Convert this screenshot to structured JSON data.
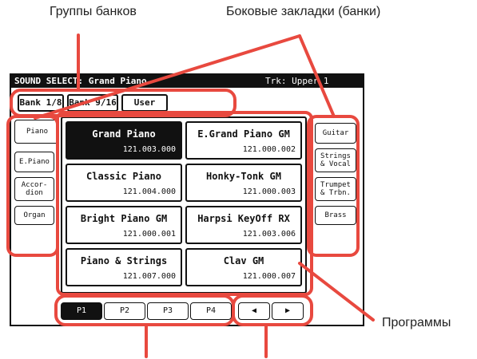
{
  "annotations": {
    "bank_groups": "Группы банков",
    "side_tabs": "Боковые закладки (банки)",
    "programs": "Программы"
  },
  "screen": {
    "title": "SOUND SELECT: Grand Piano",
    "track": "Trk: Upper 1",
    "bank_tabs": [
      {
        "label": "Bank 1/8",
        "selected": true
      },
      {
        "label": "Bank 9/16",
        "selected": false
      },
      {
        "label": "User",
        "selected": false
      }
    ],
    "left_tabs": [
      {
        "label": "Piano",
        "selected": true
      },
      {
        "label": "E.Piano",
        "selected": false
      },
      {
        "label": "Accor-\ndion",
        "selected": false
      },
      {
        "label": "Organ",
        "selected": false
      }
    ],
    "right_tabs": [
      {
        "label": "Guitar"
      },
      {
        "label": "Strings\n& Vocal"
      },
      {
        "label": "Trumpet\n& Trbn."
      },
      {
        "label": "Brass"
      }
    ],
    "programs": [
      {
        "name": "Grand Piano",
        "number": "121.003.000",
        "selected": true
      },
      {
        "name": "E.Grand Piano GM",
        "number": "121.000.002",
        "selected": false
      },
      {
        "name": "Classic Piano",
        "number": "121.004.000",
        "selected": false
      },
      {
        "name": "Honky-Tonk GM",
        "number": "121.000.003",
        "selected": false
      },
      {
        "name": "Bright Piano GM",
        "number": "121.000.001",
        "selected": false
      },
      {
        "name": "Harpsi KeyOff RX",
        "number": "121.003.006",
        "selected": false
      },
      {
        "name": "Piano & Strings",
        "number": "121.007.000",
        "selected": false
      },
      {
        "name": "Clav GM",
        "number": "121.000.007",
        "selected": false
      }
    ],
    "pages": [
      {
        "label": "P1",
        "selected": true
      },
      {
        "label": "P2",
        "selected": false
      },
      {
        "label": "P3",
        "selected": false
      },
      {
        "label": "P4",
        "selected": false
      }
    ],
    "arrows": {
      "prev_icon": "◀",
      "next_icon": "▶"
    }
  },
  "colors": {
    "highlight": "#e8493f",
    "ink": "#111111"
  }
}
